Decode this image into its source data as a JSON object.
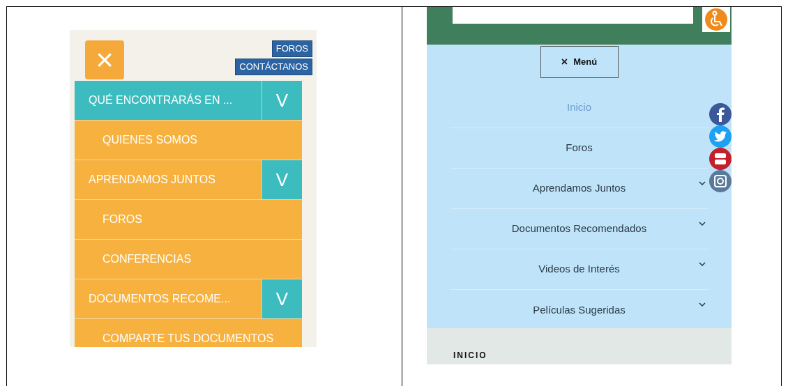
{
  "left_screenshot": {
    "close_button": "×",
    "top_links": [
      "FOROS",
      "CONTÁCTANOS"
    ],
    "menu": [
      {
        "label": "QUÉ ENCONTRARÁS EN ...",
        "kind": "main",
        "selected": true,
        "toggle": "V"
      },
      {
        "label": "QUIENES SOMOS",
        "kind": "sub",
        "selected": false
      },
      {
        "label": "APRENDAMOS JUNTOS",
        "kind": "main",
        "selected": false,
        "toggle": "V"
      },
      {
        "label": "FOROS",
        "kind": "sub",
        "selected": false
      },
      {
        "label": "CONFERENCIAS",
        "kind": "sub",
        "selected": false
      },
      {
        "label": "DOCUMENTOS RECOME...",
        "kind": "main",
        "selected": false,
        "toggle": "V"
      },
      {
        "label": "COMPARTE TUS DOCUMENTOS",
        "kind": "sub",
        "selected": false
      }
    ]
  },
  "right_screenshot": {
    "menu_button": {
      "icon": "×",
      "label": "Menú"
    },
    "menu": [
      {
        "label": "Inicio",
        "selected": true,
        "expandable": false
      },
      {
        "label": "Foros",
        "selected": false,
        "expandable": false
      },
      {
        "label": "Aprendamos Juntos",
        "selected": false,
        "expandable": true
      },
      {
        "label": "Documentos Recomendados",
        "selected": false,
        "expandable": true
      },
      {
        "label": "Videos de Interés",
        "selected": false,
        "expandable": true
      },
      {
        "label": "Películas Sugeridas",
        "selected": false,
        "expandable": true
      }
    ],
    "section_heading": "INICIO"
  }
}
